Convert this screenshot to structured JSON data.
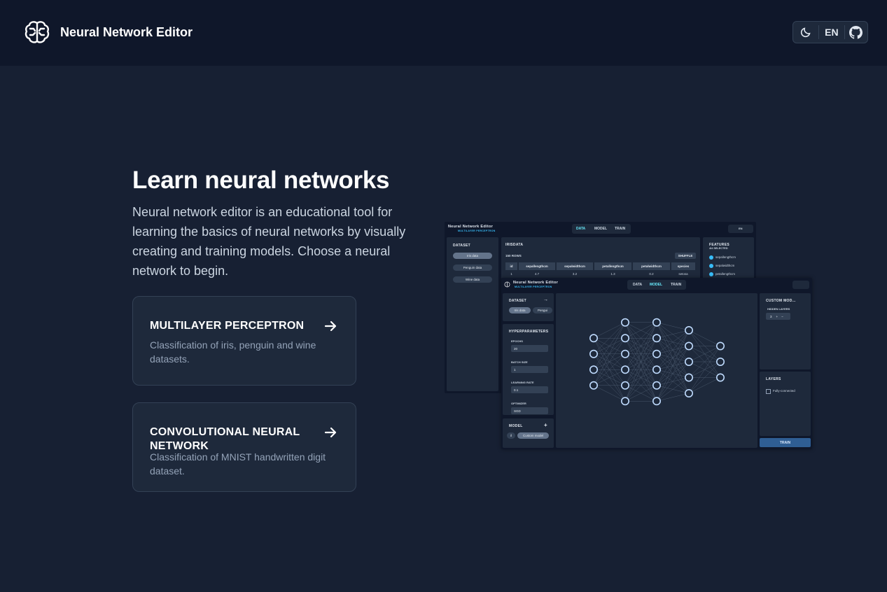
{
  "app": {
    "title": "Neural Network Editor"
  },
  "toolbar": {
    "language": "EN",
    "theme_icon": "moon-icon",
    "repo_icon": "github-icon",
    "logo_icon": "brain-icon"
  },
  "hero": {
    "title": "Learn neural networks",
    "description": "Neural network editor is an educational tool for learning the basics of neural networks by visually creating and training models. Choose a neural network to begin."
  },
  "cards": [
    {
      "title": "MULTILAYER PERCEPTRON",
      "description": "Classification of iris, penguin and wine datasets."
    },
    {
      "title": "CONVOLUTIONAL NEURAL NETWORK",
      "description": "Classification of MNIST handwritten digit dataset."
    }
  ],
  "preview_back": {
    "app_title": "Neural Network Editor",
    "app_subtitle": "MULTILAYER PERCEPTRON",
    "tabs": [
      "DATA",
      "MODEL",
      "TRAIN"
    ],
    "language": "EN",
    "dataset_heading": "DATASET",
    "datasets": [
      "Iris data",
      "Penguin data",
      "Wine data"
    ],
    "table_title": "IRISDATA",
    "row_count": "150 ROWS",
    "shuffle": "SHUFFLE",
    "columns": [
      "id",
      "sepallengthcm",
      "sepalwidthcm",
      "petallengthcm",
      "petalwidthcm",
      "species"
    ],
    "first_row": [
      "1",
      "4.7",
      "3.2",
      "1.3",
      "0.2",
      "setosa"
    ],
    "features_heading": "FEATURES",
    "features_count": "4/4 SELECTED",
    "features": [
      "sepallengthcm",
      "sepalwidthcm",
      "petallengthcm"
    ]
  },
  "preview_front": {
    "app_title": "Neural Network Editor",
    "app_subtitle": "MULTILAYER PERCEPTRON",
    "tabs": [
      "DATA",
      "MODEL",
      "TRAIN"
    ],
    "dataset_heading": "DATASET",
    "datasets": [
      "Iris data",
      "Pengui"
    ],
    "hyperparameters_heading": "HYPERPARAMETERS",
    "epochs_label": "EPOCHS",
    "epochs_value": "20",
    "batch_label": "BATCH SIZE",
    "batch_value": "1",
    "lr_label": "LEARNING RATE",
    "lr_value": "0.1",
    "optimizer_label": "OPTIMIZER",
    "optimizer_value": "SGD",
    "model_heading": "MODEL",
    "models": [
      "il",
      "Custom model"
    ],
    "custom_heading": "CUSTOM MOD...",
    "hidden_layers_label": "HIDDEN LAYERS",
    "hidden_layers_value": "3",
    "layers_heading": "LAYERS",
    "layer_item": "Fully-connected",
    "train_button": "TRAIN",
    "network_layers": [
      4,
      6,
      6,
      5,
      3
    ]
  }
}
